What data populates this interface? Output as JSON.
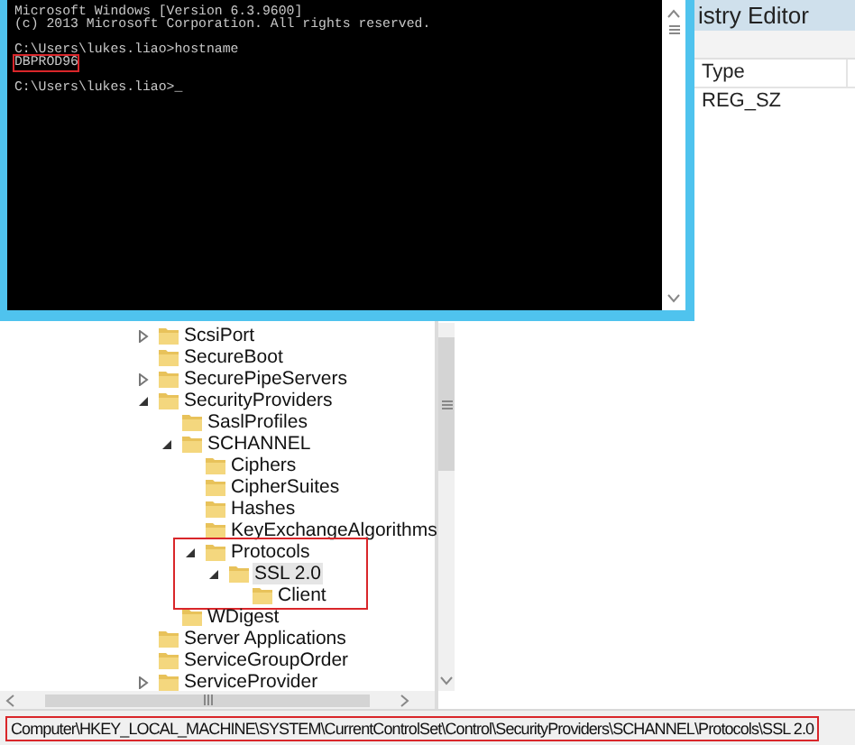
{
  "cmd_window": {
    "lines": [
      {
        "text": "Microsoft Windows [Version 6.3.9600]",
        "highlighted": false
      },
      {
        "text": "(c) 2013 Microsoft Corporation. All rights reserved.",
        "highlighted": false
      },
      {
        "text": "C:\\Users\\lukes.liao>hostname",
        "highlighted": false
      },
      {
        "text": "DBPROD96",
        "highlighted": true
      },
      {
        "text": "C:\\Users\\lukes.liao>_",
        "highlighted": false
      }
    ]
  },
  "registry_editor": {
    "title": "istry Editor",
    "tree": [
      {
        "label": "ScsiPort",
        "expanded": false,
        "selected": false
      },
      {
        "label": "SecureBoot",
        "selected": false
      },
      {
        "label": "SecurePipeServers",
        "expanded": false,
        "selected": false
      },
      {
        "label": "SecurityProviders",
        "expanded": true,
        "selected": false,
        "children": [
          {
            "label": "SaslProfiles",
            "selected": false
          },
          {
            "label": "SCHANNEL",
            "expanded": true,
            "selected": false,
            "children": [
              {
                "label": "Ciphers",
                "selected": false
              },
              {
                "label": "CipherSuites",
                "selected": false
              },
              {
                "label": "Hashes",
                "selected": false
              },
              {
                "label": "KeyExchangeAlgorithms",
                "selected": false
              },
              {
                "label": "Protocols",
                "expanded": true,
                "selected": false,
                "highlighted": true,
                "children": [
                  {
                    "label": "SSL 2.0",
                    "expanded": true,
                    "selected": true,
                    "children": [
                      {
                        "label": "Client",
                        "selected": false
                      }
                    ]
                  }
                ]
              }
            ]
          },
          {
            "label": "WDigest",
            "selected": false
          }
        ]
      },
      {
        "label": "Server Applications",
        "selected": false
      },
      {
        "label": "ServiceGroupOrder",
        "selected": false
      },
      {
        "label": "ServiceProvider",
        "expanded": false,
        "selected": false
      }
    ],
    "columns": [
      "Type"
    ],
    "rows": [
      [
        "REG_SZ"
      ]
    ],
    "status_bar": {
      "path": "Computer\\HKEY_LOCAL_MACHINE\\SYSTEM\\CurrentControlSet\\Control\\SecurityProviders\\SCHANNEL\\Protocols\\SSL 2.0",
      "highlighted": true
    }
  }
}
